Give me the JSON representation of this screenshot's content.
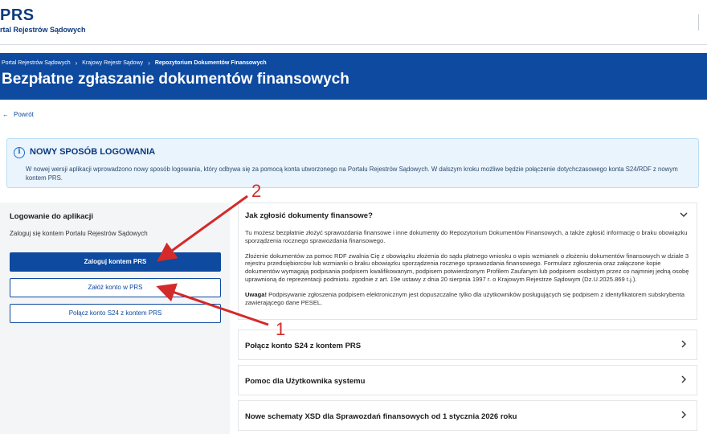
{
  "header": {
    "logo": "PRS",
    "logo_sub": "rtal Rejestrów Sądowych"
  },
  "banner": {
    "breadcrumbs": [
      "Portal Rejestrów Sądowych",
      "Krajowy Rejestr Sądowy",
      "Repozytorium Dokumentów Finansowych"
    ],
    "title": "Bezpłatne zgłaszanie dokumentów finansowych"
  },
  "back_link": "Powrót",
  "notice": {
    "title": "NOWY SPOSÓB LOGOWANIA",
    "text": "W nowej wersji aplikacji wprowadzono nowy sposób logowania, który odbywa się za pomocą konta utworzonego na Portalu Rejestrów Sądowych. W dalszym kroku możliwe będzie połączenie dotychczasowego konta S24/RDF z nowym kontem PRS."
  },
  "login": {
    "title": "Logowanie do aplikacji",
    "description": "Zaloguj się kontem Portalu Rejestrów Sądowych",
    "login_button": "Zaloguj kontem PRS",
    "create_button": "Załóż konto w PRS",
    "link_button": "Połącz konto S24 z kontem PRS"
  },
  "accordion": {
    "open": {
      "title": "Jak zgłosić dokumenty finansowe?",
      "p1": "Tu możesz bezpłatnie złożyć sprawozdania finansowe i inne dokumenty do Repozytorium Dokumentów Finansowych, a także zgłosić informację o braku obowiązku sporządzenia rocznego sprawozdania finansowego.",
      "p2": "Złożenie dokumentów za pomoc RDF zwalnia Cię z obowiązku złożenia do sądu płatnego wniosku o wpis wzmianek o złożeniu dokumentów finansowych w dziale 3 rejestru przedsiębiorców lub wzmianki o braku obowiązku sporządzenia rocznego sprawozdania finansowego. Formularz zgłoszenia oraz załączone kopie dokumentów wymagają podpisania podpisem kwalifikowanym,  podpisem potwierdzonym Profilem Zaufanym lub podpisem osobistym przez co najmniej jedną osobę uprawnioną do reprezentacji podmiotu. zgodnie z art. 19e ustawy z dnia 20 sierpnia 1997 r. o Krajowym Rejestrze Sądowym (Dz.U.2025.869 t.j.).",
      "p3_bold": "Uwaga!",
      "p3": " Podpisywanie zgłoszenia podpisem elektronicznym jest dopuszczalne tylko dla użytkowników posługujących się podpisem z identyfikatorem subskrybenta zawierającego dane PESEL."
    },
    "items": [
      "Połącz konto S24 z kontem PRS",
      "Pomoc dla Użytkownika systemu",
      "Nowe schematy XSD dla Sprawozdań finansowych od 1 stycznia 2026 roku"
    ]
  },
  "annotations": {
    "num1": "1",
    "num2": "2",
    "color": "#d42a2a"
  },
  "colors": {
    "brand": "#0d4aa0",
    "notice_bg": "#eaf4fc"
  }
}
